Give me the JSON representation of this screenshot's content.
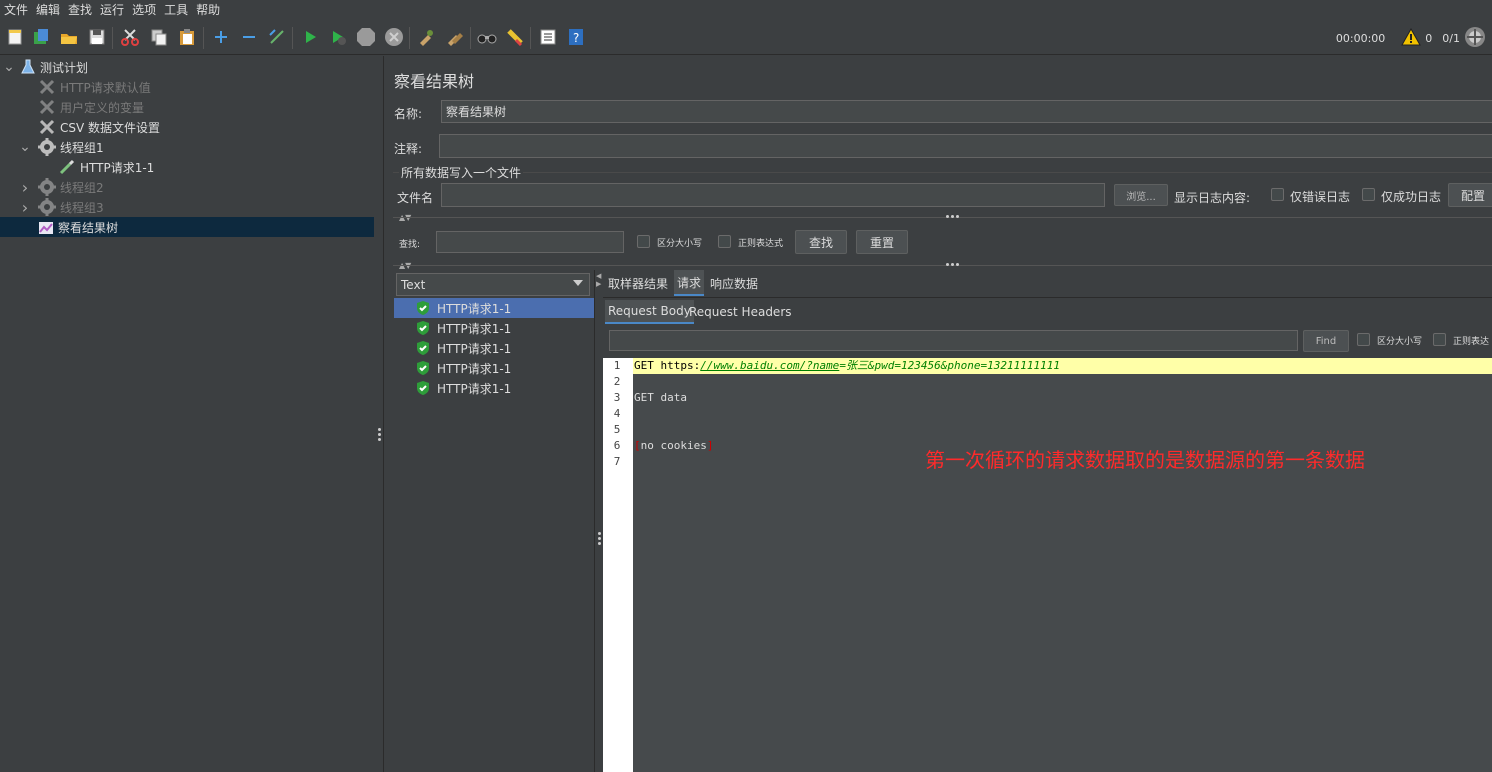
{
  "menu": [
    "文件",
    "编辑",
    "查找",
    "运行",
    "选项",
    "工具",
    "帮助"
  ],
  "toolbar": {
    "icons": [
      "new-icon",
      "templates-icon",
      "open-icon",
      "save-icon",
      "cut-icon",
      "copy-icon",
      "paste-icon",
      "expand-icon",
      "collapse-icon",
      "toggle-icon",
      "start-icon",
      "start-no-pause-icon",
      "stop-icon",
      "shutdown-icon",
      "clear-icon",
      "clear-all-icon",
      "search-icon",
      "reset-search-icon",
      "function-helper-icon",
      "help-icon"
    ],
    "timer": "00:00:00",
    "warnings": "0",
    "threads": "0/1"
  },
  "tree": [
    {
      "label": "测试计划",
      "state": "enabled",
      "icon": "flask-icon",
      "level": 0,
      "arrow": "expanded"
    },
    {
      "label": "HTTP请求默认值",
      "state": "disabled",
      "icon": "wrench-icon",
      "level": 1,
      "arrow": ""
    },
    {
      "label": "用户定义的变量",
      "state": "disabled",
      "icon": "wrench-icon",
      "level": 1,
      "arrow": ""
    },
    {
      "label": "CSV 数据文件设置",
      "state": "enabled",
      "icon": "wrench-icon",
      "level": 1,
      "arrow": ""
    },
    {
      "label": "线程组1",
      "state": "enabled",
      "icon": "gear-icon",
      "level": 1,
      "arrow": "expanded"
    },
    {
      "label": "HTTP请求1-1",
      "state": "enabled",
      "icon": "pipette-icon",
      "level": 2,
      "arrow": ""
    },
    {
      "label": "线程组2",
      "state": "disabled",
      "icon": "gear-icon",
      "level": 1,
      "arrow": "collapsed"
    },
    {
      "label": "线程组3",
      "state": "disabled",
      "icon": "gear-icon",
      "level": 1,
      "arrow": "collapsed"
    },
    {
      "label": "察看结果树",
      "state": "enabled",
      "icon": "chart-icon",
      "level": 1,
      "arrow": "",
      "selected": true
    }
  ],
  "panel": {
    "title": "察看结果树",
    "name_label": "名称:",
    "name_value": "察看结果树",
    "comment_label": "注释:",
    "comment_value": "",
    "file_section": "所有数据写入一个文件",
    "filename_label": "文件名",
    "filename_value": "",
    "browse": "浏览...",
    "log_label": "显示日志内容:",
    "errors_only": "仅错误日志",
    "success_only": "仅成功日志",
    "configure": "配置",
    "search_label": "查找:",
    "search_value": "",
    "case_sensitive": "区分大小写",
    "regex": "正则表达式",
    "search_btn": "查找",
    "reset_btn": "重置"
  },
  "renderer": "Text",
  "results": [
    "HTTP请求1-1",
    "HTTP请求1-1",
    "HTTP请求1-1",
    "HTTP请求1-1",
    "HTTP请求1-1"
  ],
  "detail": {
    "tabs": [
      "取样器结果",
      "请求",
      "响应数据"
    ],
    "active_tab": "请求",
    "subtabs": [
      "Request Body",
      "Request Headers"
    ],
    "find_btn": "Find",
    "case_sensitive": "区分大小写",
    "regex": "正则表达",
    "line_numbers": [
      "1",
      "2",
      "3",
      "4",
      "5",
      "6",
      "7"
    ],
    "line1": {
      "method": "GET https:",
      "url": "//www.baidu.com/?name",
      "eq": "=",
      "params": "张三&pwd=123456&phone=13211111111"
    },
    "line3": "GET data",
    "line6": {
      "open": "[",
      "text": "no cookies",
      "close": "]"
    }
  },
  "annotation": "第一次循环的请求数据取的是数据源的第一条数据",
  "colors": {
    "annotation": "#ff2a2a",
    "selection": "#4b6eaf",
    "highlight": "#ffffa8",
    "check": "#2e9d3a"
  }
}
